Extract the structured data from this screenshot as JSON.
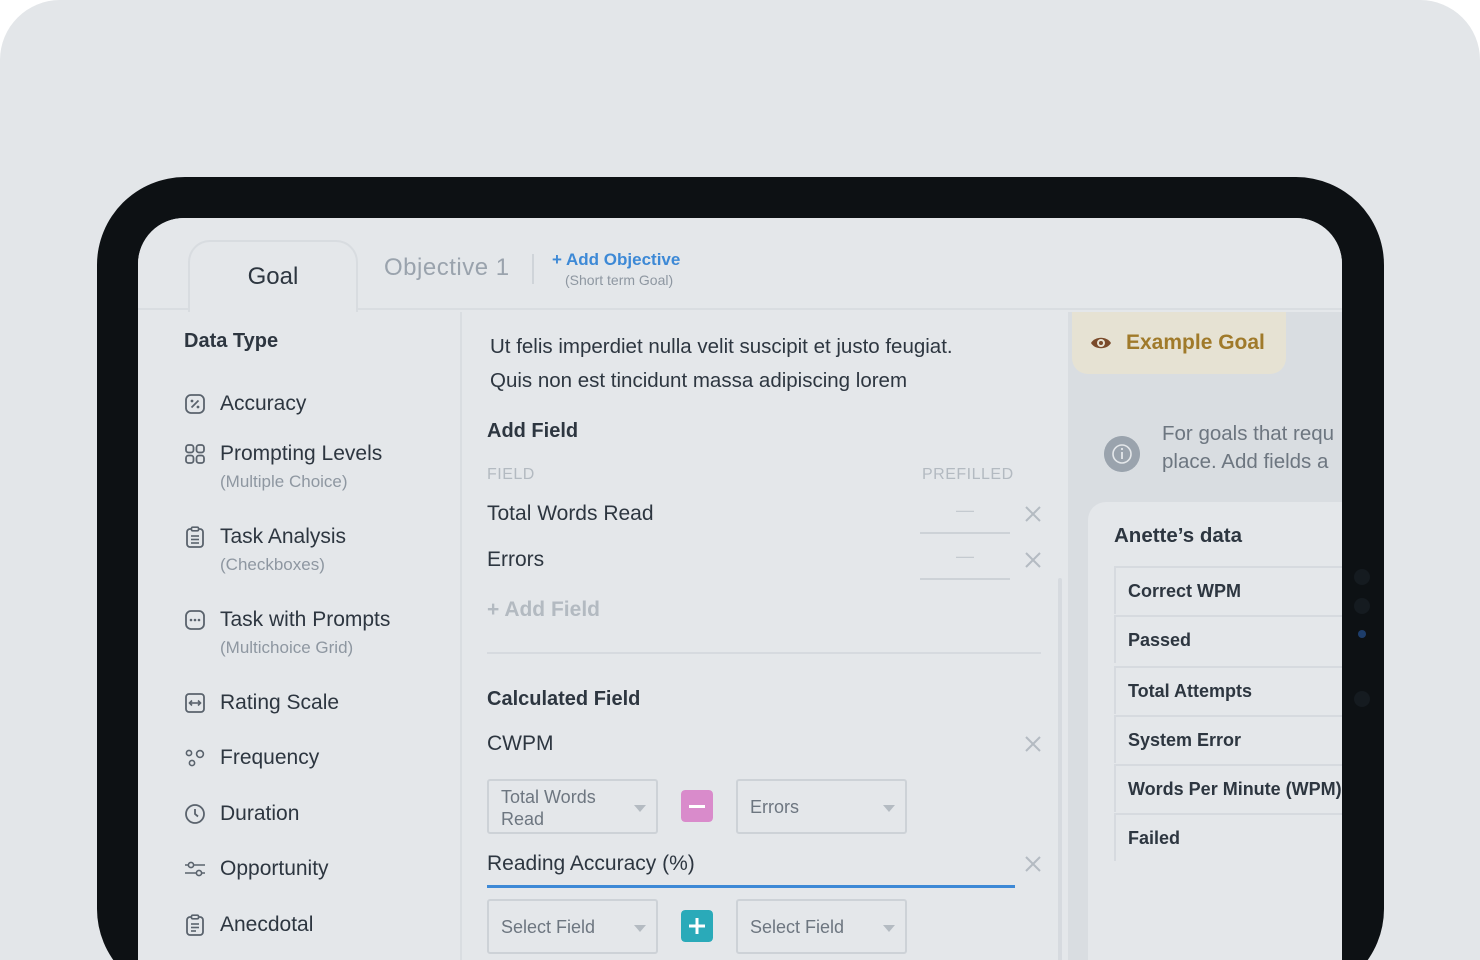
{
  "tabs": {
    "goal": "Goal",
    "objective": "Objective 1",
    "add_objective": "+ Add Objective",
    "add_objective_sub": "(Short term Goal)"
  },
  "data_type": {
    "title": "Data Type",
    "items": [
      {
        "label": "Accuracy",
        "sub": "",
        "icon": "percent-icon"
      },
      {
        "label": "Prompting Levels",
        "sub": "(Multiple Choice)",
        "icon": "grid-icon"
      },
      {
        "label": "Task Analysis",
        "sub": "(Checkboxes)",
        "icon": "clipboard-list-icon"
      },
      {
        "label": "Task with Prompts",
        "sub": "(Multichoice Grid)",
        "icon": "dots-square-icon"
      },
      {
        "label": "Rating Scale",
        "sub": "",
        "icon": "rating-scale-icon"
      },
      {
        "label": "Frequency",
        "sub": "",
        "icon": "frequency-icon"
      },
      {
        "label": "Duration",
        "sub": "",
        "icon": "clock-icon"
      },
      {
        "label": "Opportunity",
        "sub": "",
        "icon": "sliders-icon"
      },
      {
        "label": "Anecdotal",
        "sub": "",
        "icon": "notes-icon"
      }
    ]
  },
  "main": {
    "description_line1": "Ut felis imperdiet nulla velit suscipit et justo feugiat.",
    "description_line2": "Quis non est tincidunt massa adipiscing lorem",
    "add_field_title": "Add Field",
    "col_field": "FIELD",
    "col_prefilled": "PREFILLED",
    "fields": [
      {
        "name": "Total Words Read",
        "prefilled": "—"
      },
      {
        "name": "Errors",
        "prefilled": "—"
      }
    ],
    "add_field_link": "+ Add Field",
    "calculated_title": "Calculated Field",
    "calc1": {
      "name": "CWPM",
      "left": "Total Words Read",
      "left_line1": "Total Words",
      "left_line2": "Read",
      "operator": "minus",
      "right": "Errors"
    },
    "calc2": {
      "name": "Reading Accuracy (%)",
      "left": "Select Field",
      "operator": "plus",
      "right": "Select Field"
    }
  },
  "example": {
    "label": "Example Goal",
    "info_line1": "For goals that requ",
    "info_line2": "place. Add fields a",
    "card_title": "Anette’s data",
    "rows": [
      "Correct WPM",
      "Passed",
      "Total Attempts",
      "System Error",
      "Words Per Minute (WPM)",
      "Failed"
    ]
  },
  "colors": {
    "accent": "#3d89d6",
    "minus": "#d98bcb",
    "plus": "#2aaab9",
    "example_text": "#a07a2a"
  }
}
